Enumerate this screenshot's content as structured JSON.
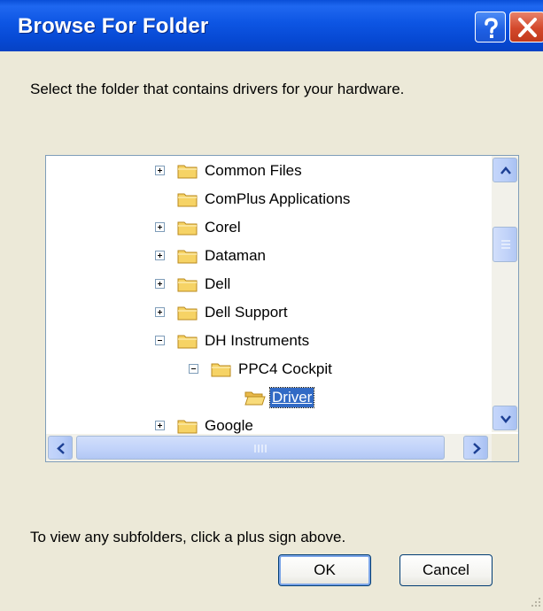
{
  "window": {
    "title": "Browse For Folder",
    "help_icon": "question-mark-icon",
    "close_icon": "close-x-icon"
  },
  "prompt": "Select the folder that contains drivers for your hardware.",
  "tree": {
    "nodes": [
      {
        "label": "Common Files",
        "expander": "plus",
        "level": 0
      },
      {
        "label": "ComPlus Applications",
        "expander": "none",
        "level": 0
      },
      {
        "label": "Corel",
        "expander": "plus",
        "level": 0
      },
      {
        "label": "Dataman",
        "expander": "plus",
        "level": 0
      },
      {
        "label": "Dell",
        "expander": "plus",
        "level": 0
      },
      {
        "label": "Dell Support",
        "expander": "plus",
        "level": 0
      },
      {
        "label": "DH Instruments",
        "expander": "minus",
        "level": 0
      },
      {
        "label": "PPC4 Cockpit",
        "expander": "minus",
        "level": 1
      },
      {
        "label": "Driver",
        "expander": "none",
        "level": 2,
        "selected": true
      },
      {
        "label": "Google",
        "expander": "plus",
        "level": 0
      }
    ]
  },
  "hint": "To view any subfolders, click a plus sign above.",
  "buttons": {
    "ok": "OK",
    "cancel": "Cancel"
  },
  "colors": {
    "titlebar": "#0a4fd8",
    "selection": "#316ac5",
    "dialog_bg": "#ece9d8",
    "folder": "#f6d365"
  }
}
